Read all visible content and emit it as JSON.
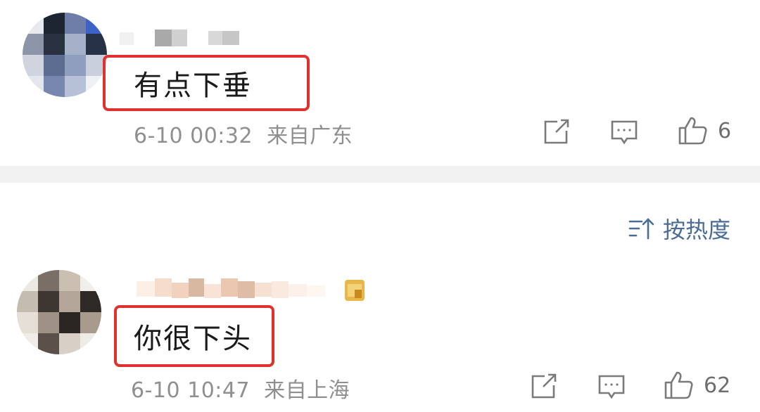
{
  "comments": [
    {
      "text": "有点下垂",
      "date": "6-10 00:32",
      "location": "来自广东",
      "likes": "6"
    },
    {
      "text": "你很下头",
      "date": "6-10 10:47",
      "location": "来自上海",
      "likes": "62"
    }
  ],
  "sort": {
    "label": "按热度"
  },
  "icons": {
    "share": "share-icon",
    "reply": "comment-icon",
    "like": "thumbs-up-icon",
    "sort": "sort-icon"
  },
  "colors": {
    "highlight_border": "#e0312f",
    "sort_text": "#4a6d96",
    "meta_text": "#8f8f8f",
    "divider": "#f2f2f2"
  }
}
